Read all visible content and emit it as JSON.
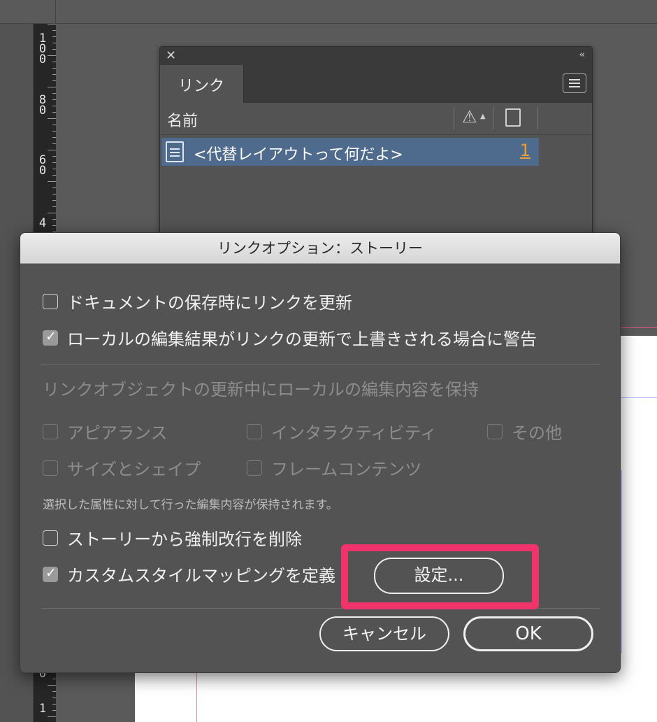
{
  "ruler": {
    "labels": [
      {
        "id": "100",
        "chars": [
          "1",
          "0",
          "0"
        ]
      },
      {
        "id": "80",
        "chars": [
          "8",
          "0"
        ]
      },
      {
        "id": "60",
        "chars": [
          "6",
          "0"
        ]
      },
      {
        "id": "4",
        "chars": [
          "4"
        ]
      },
      {
        "id": "0",
        "chars": [
          "0"
        ]
      },
      {
        "id": "1",
        "chars": [
          "1"
        ]
      }
    ]
  },
  "links_panel": {
    "close_glyph": "✕",
    "collapse_glyph": "‹‹",
    "tab_label": "リンク",
    "menu_icon": "panel-menu-icon",
    "column_name": "名前",
    "warning_icon": "⚠",
    "warning_sort": "▲",
    "page_column_icon": "page-icon",
    "row": {
      "icon": "text-document-icon",
      "filename": "<代替レイアウトって何だよ>",
      "page_number": "1"
    },
    "selection_color": "#4e6a8c"
  },
  "dialog": {
    "title": "リンクオプション：ストーリー",
    "options": {
      "update_on_save": {
        "label": "ドキュメントの保存時にリンクを更新",
        "checked": false
      },
      "warn_overwrite": {
        "label": "ローカルの編集結果がリンクの更新で上書きされる場合に警告",
        "checked": true
      }
    },
    "preserve_section_label": "リンクオブジェクトの更新中にローカルの編集内容を保持",
    "preserve_options": {
      "appearance": {
        "label": "アピアランス",
        "checked": false,
        "enabled": false
      },
      "interactivity": {
        "label": "インタラクティビティ",
        "checked": false,
        "enabled": false
      },
      "others": {
        "label": "その他",
        "checked": false,
        "enabled": false
      },
      "size_shape": {
        "label": "サイズとシェイプ",
        "checked": false,
        "enabled": false
      },
      "frame_content": {
        "label": "フレームコンテンツ",
        "checked": false,
        "enabled": false
      }
    },
    "preserve_note": "選択した属性に対して行った編集内容が保持されます。",
    "remove_breaks": {
      "label": "ストーリーから強制改行を削除",
      "checked": false
    },
    "custom_mapping": {
      "label": "カスタムスタイルマッピングを定義",
      "checked": true
    },
    "settings_button": "設定...",
    "cancel_button": "キャンセル",
    "ok_button": "OK"
  },
  "colors": {
    "highlight_annotation": "#f0346b",
    "page_number_accent": "#f0a030"
  }
}
